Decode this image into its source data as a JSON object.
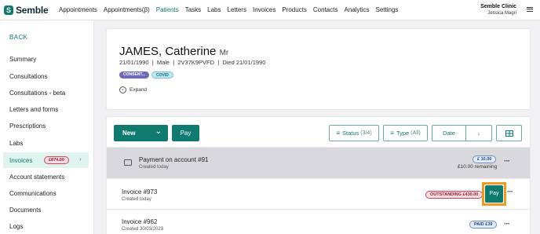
{
  "app": {
    "logo_mark": "S",
    "logo_text": "Semble",
    "brand_color": "#0e7a70"
  },
  "nav": {
    "items": [
      "Appointments",
      "Appointments(β)",
      "Patients",
      "Tasks",
      "Labs",
      "Letters",
      "Invoices",
      "Products",
      "Contacts",
      "Analytics",
      "Settings"
    ],
    "active": "Patients"
  },
  "account": {
    "clinic": "Semble Clinic",
    "user": "Jessica Magri",
    "menu_icon": "hamburger-menu-icon"
  },
  "sidebar": {
    "back_label": "BACK",
    "items": [
      "Summary",
      "Consultations",
      "Consultations - beta",
      "Letters and forms",
      "Prescriptions",
      "Labs",
      "Invoices",
      "Account statements",
      "Communications",
      "Documents",
      "Logs"
    ],
    "active_item": "Invoices",
    "invoices_badge": "£874.00"
  },
  "patient": {
    "name": "JAMES, Catherine",
    "title": "Mr",
    "details": "21/01/1990  |  Male  |  2V37K9PVFD  |  Died 21/01/1990",
    "tags": [
      "CONSENT...",
      "COVID"
    ],
    "expand_label": "Expand"
  },
  "toolbar": {
    "new_label": "New",
    "pay_label": "Pay",
    "status_filter": {
      "label": "Status",
      "count": "(3/4)"
    },
    "type_filter": {
      "label": "Type",
      "count": "(All)"
    },
    "date_label": "Date",
    "sort_icon": "arrow-down-icon",
    "view_icon": "grid-view-icon"
  },
  "invoices": [
    {
      "title": "Payment on account #91",
      "subtitle": "Created today",
      "badge": "£ 10.00",
      "remaining": "£10.00 remaining"
    },
    {
      "title": "Invoice #973",
      "subtitle": "Created today",
      "badge": "OUTSTANDING £430.00",
      "action": "Pay"
    },
    {
      "title": "Invoice #962",
      "subtitle": "Created 30/03/2023",
      "badge": "PAID £39"
    }
  ]
}
